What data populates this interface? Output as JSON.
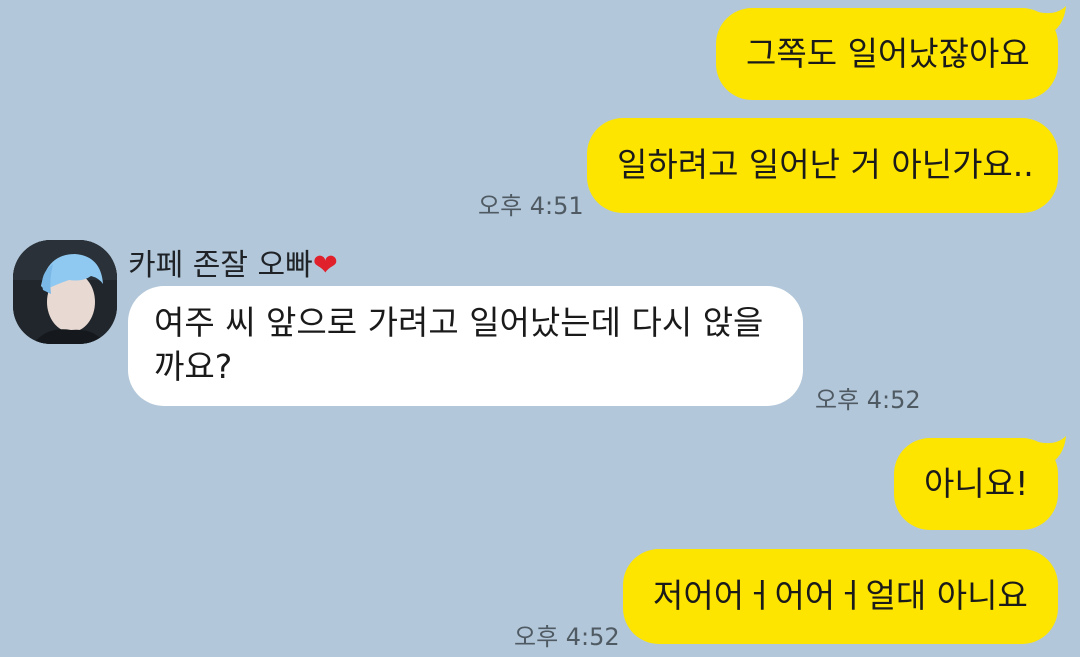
{
  "messages": [
    {
      "side": "me",
      "text": "그쪽도 일어났잖아요"
    },
    {
      "side": "me",
      "text": "일하려고 일어난 거 아닌가요.."
    },
    {
      "side": "other",
      "text": "여주 씨 앞으로 가려고 일어났는데 다시 앉을까요?"
    },
    {
      "side": "me",
      "text": "아니요!"
    },
    {
      "side": "me",
      "text": "저어어ㅓ어어ㅓ얼대 아니요"
    }
  ],
  "timestamps": {
    "t1": "오후 4:51",
    "t2": "오후 4:52",
    "t3": "오후 4:52"
  },
  "sender": {
    "name": "카페 존잘 오빠",
    "emoji": "❤"
  },
  "colors": {
    "background": "#b2c7d9",
    "my_bubble": "#fee500",
    "other_bubble": "#ffffff",
    "timestamp": "#4f5a63"
  }
}
